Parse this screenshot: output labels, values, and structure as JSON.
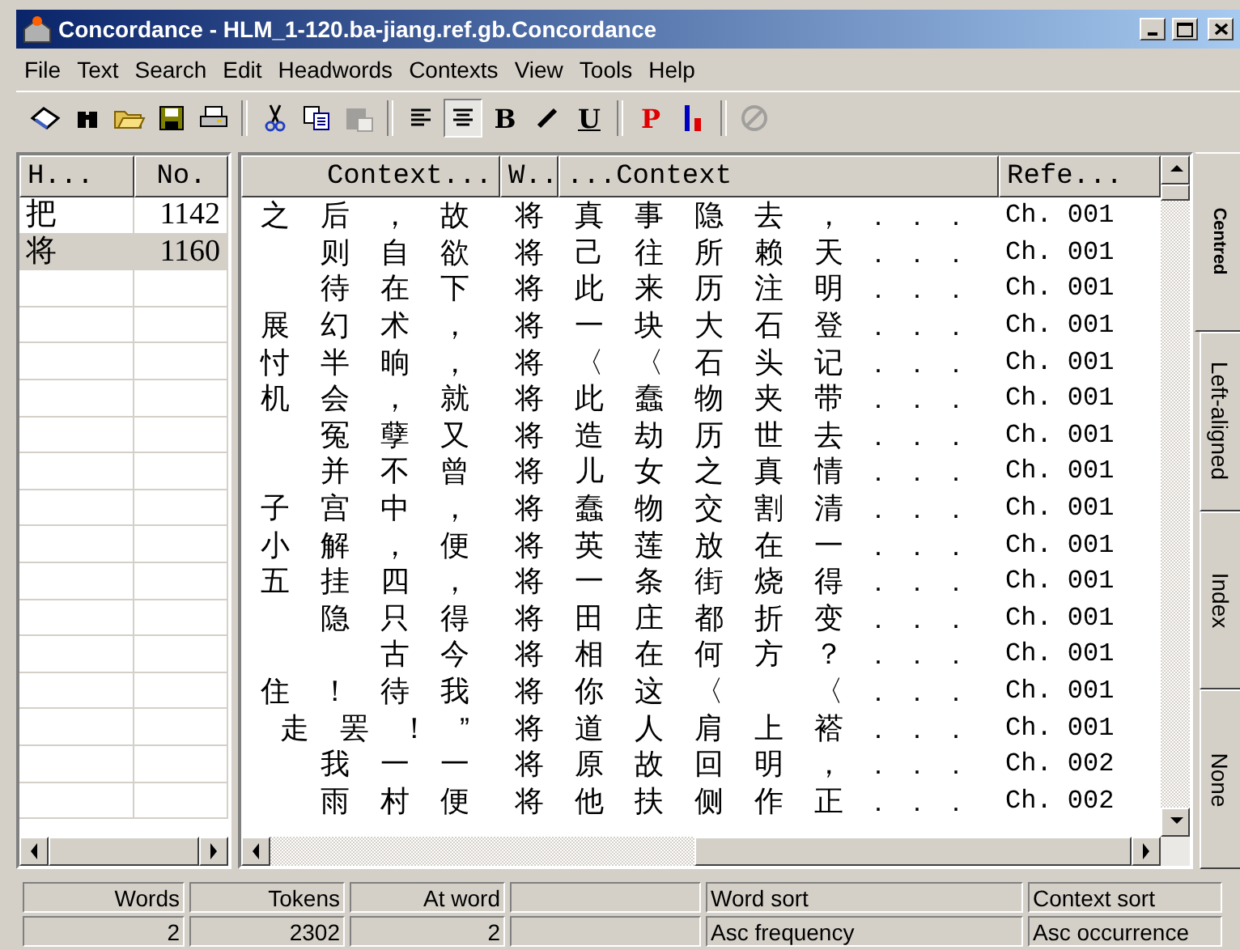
{
  "window": {
    "title": "Concordance - HLM_1-120.ba-jiang.ref.gb.Concordance"
  },
  "menu": [
    "File",
    "Text",
    "Search",
    "Edit",
    "Headwords",
    "Contexts",
    "View",
    "Tools",
    "Help"
  ],
  "toolbar": [
    {
      "kind": "icon",
      "pressed": false,
      "disabled": false
    },
    {
      "kind": "icon",
      "pressed": false,
      "disabled": false
    },
    {
      "kind": "icon",
      "pressed": false,
      "disabled": false
    },
    {
      "kind": "icon",
      "pressed": false,
      "disabled": false
    },
    {
      "kind": "icon",
      "pressed": false,
      "disabled": false
    },
    {
      "kind": "sep"
    },
    {
      "kind": "icon",
      "pressed": false,
      "disabled": false
    },
    {
      "kind": "icon",
      "pressed": false,
      "disabled": false
    },
    {
      "kind": "icon",
      "pressed": false,
      "disabled": true
    },
    {
      "kind": "sep"
    },
    {
      "kind": "icon",
      "pressed": false,
      "disabled": false
    },
    {
      "kind": "icon",
      "pressed": true,
      "disabled": false
    },
    {
      "kind": "text",
      "label": "B",
      "pressed": false,
      "disabled": false
    },
    {
      "kind": "icon",
      "pressed": false,
      "disabled": false
    },
    {
      "kind": "text",
      "label": "U",
      "pressed": false,
      "disabled": false
    },
    {
      "kind": "sep"
    },
    {
      "kind": "text",
      "label": "P",
      "pressed": false,
      "disabled": false
    },
    {
      "kind": "icon",
      "pressed": false,
      "disabled": false
    },
    {
      "kind": "sep"
    },
    {
      "kind": "icon",
      "pressed": false,
      "disabled": true
    }
  ],
  "headwords": {
    "columns": [
      "H...",
      "No."
    ],
    "rows": [
      {
        "word": "把",
        "count": "1142",
        "selected": false
      },
      {
        "word": "将",
        "count": "1160",
        "selected": true
      }
    ]
  },
  "concordance": {
    "columns": [
      "Context...",
      "W..",
      "...Context",
      "Refe..."
    ],
    "rows": [
      {
        "left": "之后，故",
        "word": "将",
        "right": "真事隐去，...",
        "ref": "Ch. 001"
      },
      {
        "left": "　则自欲",
        "word": "将",
        "right": "己往所赖天...",
        "ref": "Ch. 001"
      },
      {
        "left": "　待在下",
        "word": "将",
        "right": "此来历注明...",
        "ref": "Ch. 001"
      },
      {
        "left": "展幻术，",
        "word": "将",
        "right": "一块大石登...",
        "ref": "Ch. 001"
      },
      {
        "left": "忖半晌，",
        "word": "将",
        "right": "〈〈石头记...",
        "ref": "Ch. 001"
      },
      {
        "left": "机会，就",
        "word": "将",
        "right": "此蠢物夹带...",
        "ref": "Ch. 001"
      },
      {
        "left": "　冤孽又",
        "word": "将",
        "right": "造劫历世去...",
        "ref": "Ch. 001"
      },
      {
        "left": "　并不曾",
        "word": "将",
        "right": "儿女之真情...",
        "ref": "Ch. 001"
      },
      {
        "left": "子宫中，",
        "word": "将",
        "right": "蠢物交割清...",
        "ref": "Ch. 001"
      },
      {
        "left": "小解，便",
        "word": "将",
        "right": "英莲放在一...",
        "ref": "Ch. 001"
      },
      {
        "left": "五挂四，",
        "word": "将",
        "right": "一条街烧得...",
        "ref": "Ch. 001"
      },
      {
        "left": "　隐只得",
        "word": "将",
        "right": "田庄都折变...",
        "ref": "Ch. 001"
      },
      {
        "left": "　　古今",
        "word": "将",
        "right": "相在何方？...",
        "ref": "Ch. 001"
      },
      {
        "left": "住！待我",
        "word": "将",
        "right": "你这〈　〈...",
        "ref": "Ch. 001"
      },
      {
        "left": "走罢！”",
        "word": "将",
        "right": "道人肩上褡...",
        "ref": "Ch. 001"
      },
      {
        "left": "　我一一",
        "word": "将",
        "right": "原故回明，...",
        "ref": "Ch. 002"
      },
      {
        "left": "　雨村便",
        "word": "将",
        "right": "他扶侧作正...",
        "ref": "Ch. 002"
      }
    ]
  },
  "side_tabs": [
    {
      "label": "Centred",
      "selected": true
    },
    {
      "label": "Left-aligned",
      "selected": false
    },
    {
      "label": "Index",
      "selected": false
    },
    {
      "label": "None",
      "selected": false
    }
  ],
  "status_bar": [
    {
      "kind": "field",
      "label": "Words",
      "value": "2"
    },
    {
      "kind": "field",
      "label": "Tokens",
      "value": "2302"
    },
    {
      "kind": "field",
      "label": "At word",
      "value": "2"
    },
    {
      "kind": "blank"
    },
    {
      "kind": "field",
      "label": "Word sort",
      "value": "Asc frequency"
    },
    {
      "kind": "field",
      "label": "Context sort",
      "value": "Asc occurrence"
    }
  ]
}
